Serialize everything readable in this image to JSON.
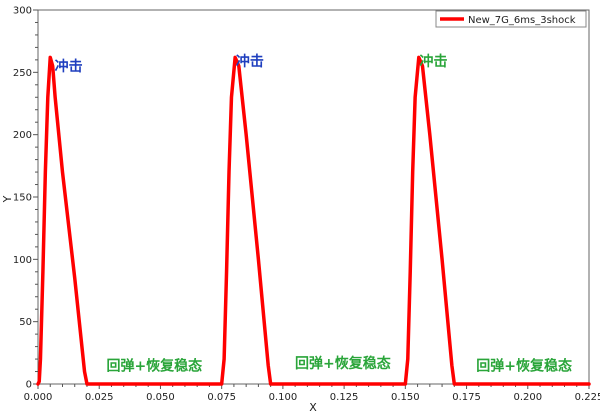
{
  "chart_data": {
    "type": "line",
    "xlabel": "X",
    "ylabel": "Y",
    "xlim": [
      0,
      0.225
    ],
    "ylim": [
      0,
      300
    ],
    "x_ticks": [
      "0.000",
      "0.025",
      "0.050",
      "0.075",
      "0.100",
      "0.125",
      "0.150",
      "0.175",
      "0.200",
      "0.225"
    ],
    "y_ticks": [
      "0",
      "50",
      "100",
      "150",
      "200",
      "250",
      "300"
    ],
    "grid": true,
    "legend_position": "top-right",
    "series": [
      {
        "name": "New_7G_6ms_3shock",
        "color": "#ff0000",
        "x": [
          0,
          0.0005,
          0.001,
          0.002,
          0.003,
          0.004,
          0.005,
          0.006,
          0.007,
          0.01,
          0.015,
          0.019,
          0.02,
          0.075,
          0.076,
          0.077,
          0.078,
          0.079,
          0.0805,
          0.082,
          0.085,
          0.09,
          0.094,
          0.095,
          0.15,
          0.151,
          0.152,
          0.153,
          0.154,
          0.1555,
          0.157,
          0.16,
          0.165,
          0.169,
          0.17,
          0.225
        ],
        "y": [
          0,
          2,
          20,
          90,
          170,
          230,
          262,
          255,
          230,
          170,
          85,
          10,
          0,
          0,
          20,
          90,
          170,
          230,
          262,
          255,
          200,
          100,
          15,
          0,
          0,
          20,
          90,
          170,
          230,
          262,
          255,
          200,
          100,
          15,
          0,
          0
        ]
      }
    ],
    "annotations": [
      {
        "text": "冲击",
        "x": 0.0125,
        "y": 255,
        "color": "#1f3fbf"
      },
      {
        "text": "冲击",
        "x": 0.0865,
        "y": 259,
        "color": "#1f3fbf"
      },
      {
        "text": "冲击",
        "x": 0.1615,
        "y": 259,
        "color": "#2aa53a"
      },
      {
        "text": "回弹+恢复稳态",
        "x": 0.0475,
        "y": 15,
        "color": "#2aa53a"
      },
      {
        "text": "回弹+恢复稳态",
        "x": 0.1245,
        "y": 17,
        "color": "#2aa53a"
      },
      {
        "text": "回弹+恢复稳态",
        "x": 0.1985,
        "y": 15,
        "color": "#2aa53a"
      }
    ]
  }
}
